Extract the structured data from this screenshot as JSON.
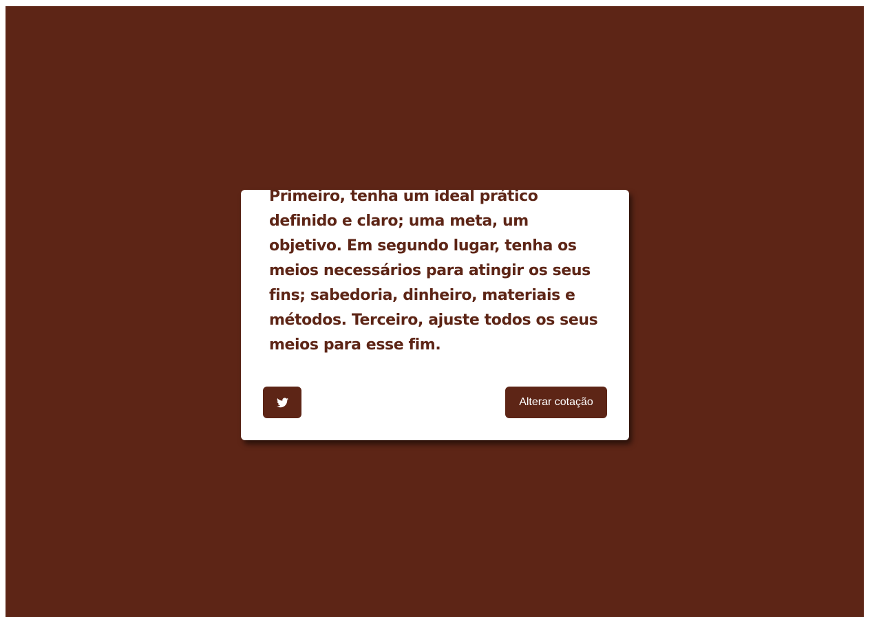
{
  "quote": {
    "text": "Primeiro, tenha um ideal prático definido e claro; uma meta, um objetivo. Em segundo lugar, tenha os meios necessários para atingir os seus fins; sabedoria, dinheiro, materiais e métodos. Terceiro, ajuste todos os seus meios para esse fim."
  },
  "actions": {
    "tweet_icon": "twitter-icon",
    "new_quote_label": "Alterar cotação"
  },
  "colors": {
    "background": "#5d2516",
    "card": "#ffffff",
    "accent": "#5d2516"
  }
}
